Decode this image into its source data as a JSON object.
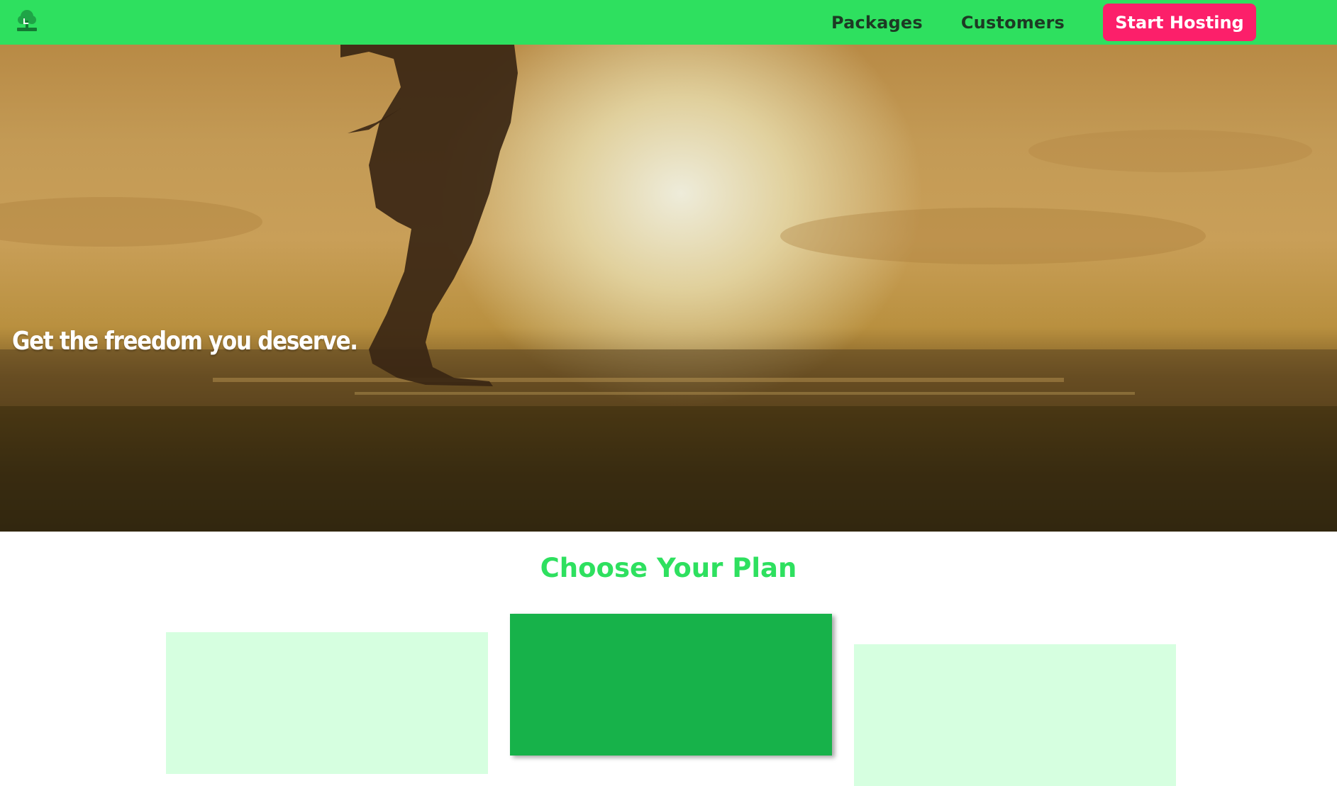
{
  "nav": {
    "logo_icon": "tree-logo-icon",
    "links": [
      {
        "label": "Packages"
      },
      {
        "label": "Customers"
      }
    ],
    "cta_label": "Start Hosting"
  },
  "hero": {
    "headline": "Get the freedom you deserve."
  },
  "plans": {
    "title": "Choose Your Plan"
  },
  "colors": {
    "nav_bg": "#2ee05f",
    "cta_bg": "#fc1f6a",
    "accent_green": "#2ee05f",
    "featured_card": "#17b24a",
    "light_card": "#d6ffe0"
  }
}
